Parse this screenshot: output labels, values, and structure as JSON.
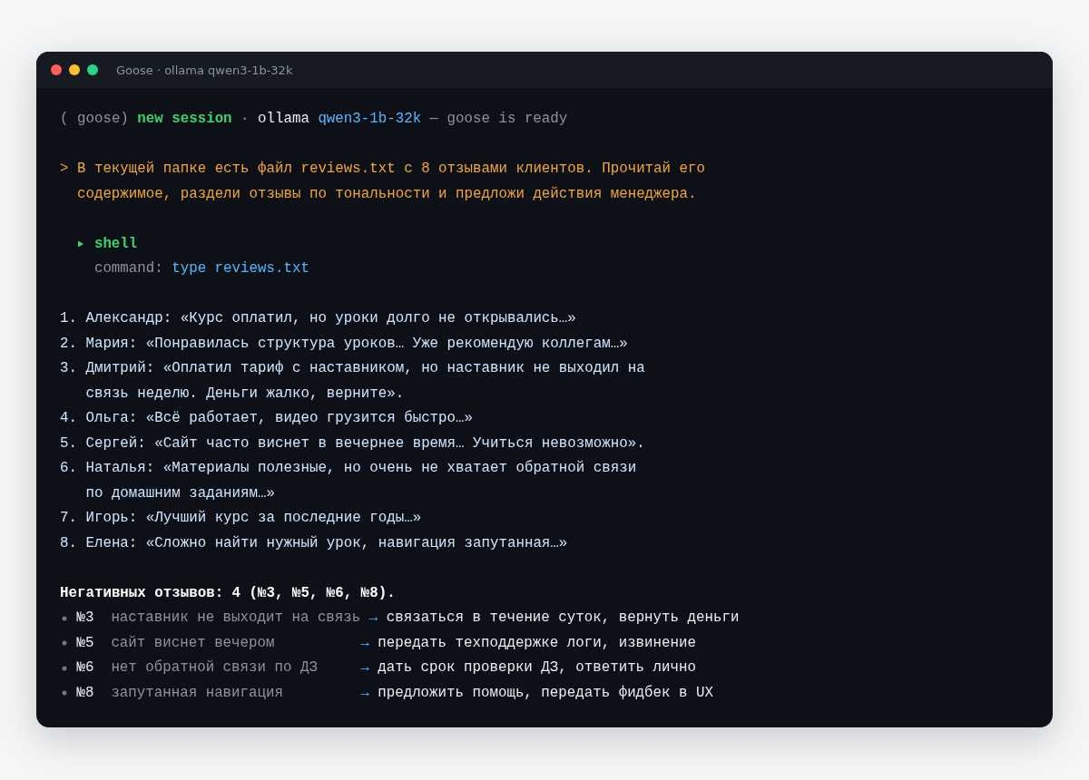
{
  "window": {
    "title": "Goose · ollama qwen3-1b-32k"
  },
  "header": {
    "app": "( goose)",
    "session": "new session",
    "separator": "·",
    "provider": "ollama",
    "model": "qwen3-1b-32k",
    "status": "— goose is ready"
  },
  "prompt": {
    "marker": ">",
    "text": "В текущей папке есть файл reviews.txt с 8 отзывами клиентов. Прочитай его содержимое, раздели отзывы по тональности и предложи действия менеджера."
  },
  "tool_call": {
    "name": "shell",
    "label": "command:",
    "value": "type reviews.txt"
  },
  "reviews": [
    {
      "number": "1.",
      "text": "Александр: «Курс оплатил, но уроки долго не открывались…»"
    },
    {
      "number": "2.",
      "text": "Мария: «Понравилась структура уроков… Уже рекомендую коллегам…»"
    },
    {
      "number": "3.",
      "text": "Дмитрий: «Оплатил тариф с наставником, но наставник не выходил на связь неделю. Деньги жалко, верните»."
    },
    {
      "number": "4.",
      "text": "Ольга: «Всё работает, видео грузится быстро…»"
    },
    {
      "number": "5.",
      "text": "Сергей: «Сайт часто виснет в вечернее время… Учиться невозможно»."
    },
    {
      "number": "6.",
      "text": "Наталья: «Материалы полезные, но очень не хватает обратной связи по домашним заданиям…»"
    },
    {
      "number": "7.",
      "text": "Игорь: «Лучший курс за последние годы…»"
    },
    {
      "number": "8.",
      "text": "Елена: «Сложно найти нужный урок, навигация запутанная…»"
    }
  ],
  "summary": "Негативных отзывов: 4 (№3, №5, №6, №8).",
  "actions": [
    {
      "ref": "№3",
      "issue": "наставник не выходит на связь",
      "arrow": "→",
      "action": "связаться в течение суток, вернуть деньги"
    },
    {
      "ref": "№5",
      "issue": "сайт виснет вечером",
      "arrow": "→",
      "action": "передать техподдержке логи, извинение"
    },
    {
      "ref": "№6",
      "issue": "нет обратной связи по ДЗ",
      "arrow": "→",
      "action": "дать срок проверки ДЗ, ответить лично"
    },
    {
      "ref": "№8",
      "issue": "запутанная навигация",
      "arrow": "→",
      "action": "предложить помощь, передать фидбек в UX"
    }
  ]
}
